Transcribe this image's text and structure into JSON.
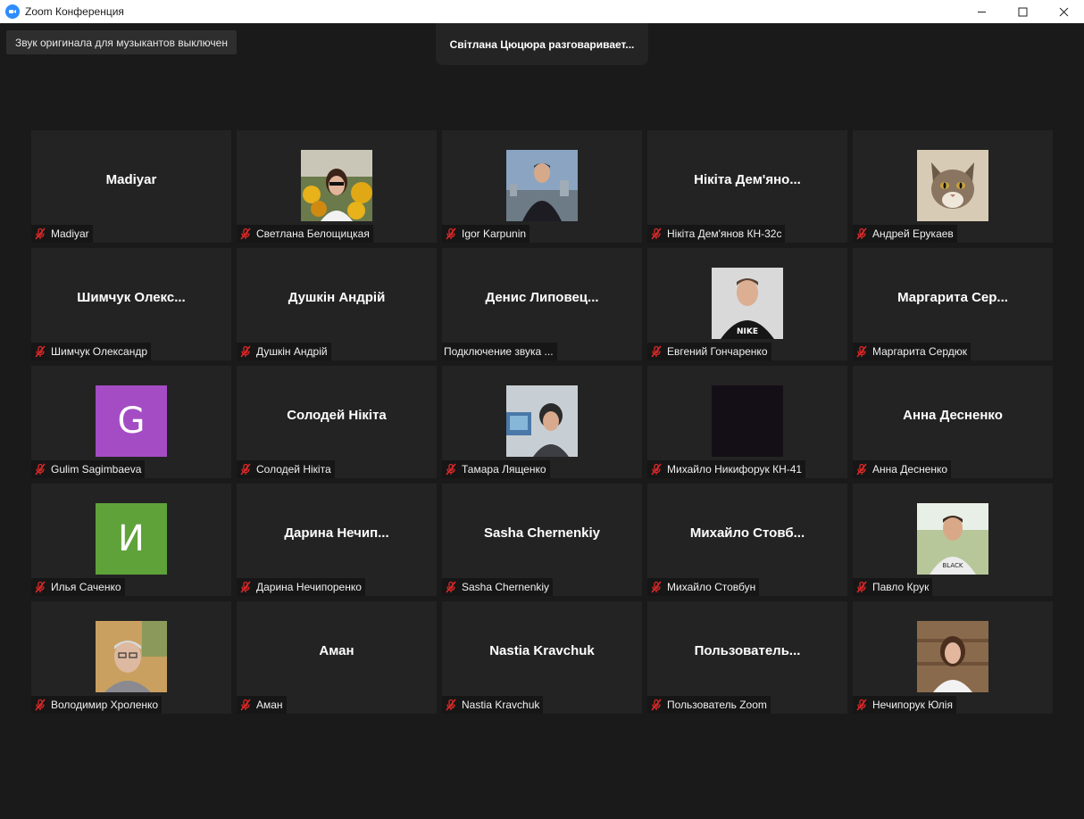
{
  "window": {
    "title": "Zoom Конференция"
  },
  "toast": "Звук оригинала для музыкантов выключен",
  "speaker_banner": "Світлана Цюцюра разговаривает...",
  "colors": {
    "mute": "#e02828",
    "accent": "#2d8cff"
  },
  "participants": [
    {
      "display": "Madiyar",
      "label": "Madiyar",
      "muted": true,
      "avatar": null
    },
    {
      "display": "",
      "label": "Светлана Белощицкая",
      "muted": true,
      "avatar": "photo-woman-flowers"
    },
    {
      "display": "",
      "label": "Igor Karpunin",
      "muted": true,
      "avatar": "photo-man-city"
    },
    {
      "display": "Нікіта Дем'яно...",
      "label": "Нікіта Дем'янов КН-32с",
      "muted": true,
      "avatar": null
    },
    {
      "display": "",
      "label": "Андрей Ерукаев",
      "muted": true,
      "avatar": "photo-cat"
    },
    {
      "display": "Шимчук Олекс...",
      "label": "Шимчук Олександр",
      "muted": true,
      "avatar": null
    },
    {
      "display": "Душкін Андрій",
      "label": "Душкін Андрій",
      "muted": true,
      "avatar": null
    },
    {
      "display": "Денис Липовец...",
      "label": "Подключение звука ...",
      "muted": false,
      "avatar": null
    },
    {
      "display": "",
      "label": "Евгений Гончаренко",
      "muted": true,
      "avatar": "photo-man-nike"
    },
    {
      "display": "Маргарита Сер...",
      "label": "Маргарита Сердюк",
      "muted": true,
      "avatar": null
    },
    {
      "display": "",
      "label": "Gulim Sagimbaeva",
      "muted": true,
      "avatar": "letter",
      "letter": "G",
      "letter_color": "#a44cc4"
    },
    {
      "display": "Солодей Нікіта",
      "label": "Солодей Нікіта",
      "muted": true,
      "avatar": null
    },
    {
      "display": "",
      "label": "Тамара Лященко",
      "muted": true,
      "avatar": "photo-woman-desk"
    },
    {
      "display": "",
      "label": "Михайло Никифорук КН-41",
      "muted": true,
      "avatar": "photo-dark"
    },
    {
      "display": "Анна Десненко",
      "label": "Анна Десненко",
      "muted": true,
      "avatar": null
    },
    {
      "display": "",
      "label": "Илья Саченко",
      "muted": true,
      "avatar": "letter",
      "letter": "И",
      "letter_color": "#5fa23a"
    },
    {
      "display": "Дарина Нечип...",
      "label": "Дарина Нечипоренко",
      "muted": true,
      "avatar": null
    },
    {
      "display": "Sasha Chernenkiy",
      "label": "Sasha Chernenkiy",
      "muted": true,
      "avatar": null
    },
    {
      "display": "Михайло Стовб...",
      "label": "Михайло Стовбун",
      "muted": true,
      "avatar": null
    },
    {
      "display": "",
      "label": "Павло Крук",
      "muted": true,
      "avatar": "photo-man-outdoor"
    },
    {
      "display": "",
      "label": "Володимир Хроленко",
      "muted": true,
      "avatar": "photo-old-man"
    },
    {
      "display": "Аман",
      "label": "Аман",
      "muted": true,
      "avatar": null
    },
    {
      "display": "Nastia Kravchuk",
      "label": "Nastia Kravchuk",
      "muted": true,
      "avatar": null
    },
    {
      "display": "Пользователь...",
      "label": "Пользователь Zoom",
      "muted": true,
      "avatar": null
    },
    {
      "display": "",
      "label": "Нечипорук Юлія",
      "muted": true,
      "avatar": "photo-woman-wood"
    }
  ]
}
